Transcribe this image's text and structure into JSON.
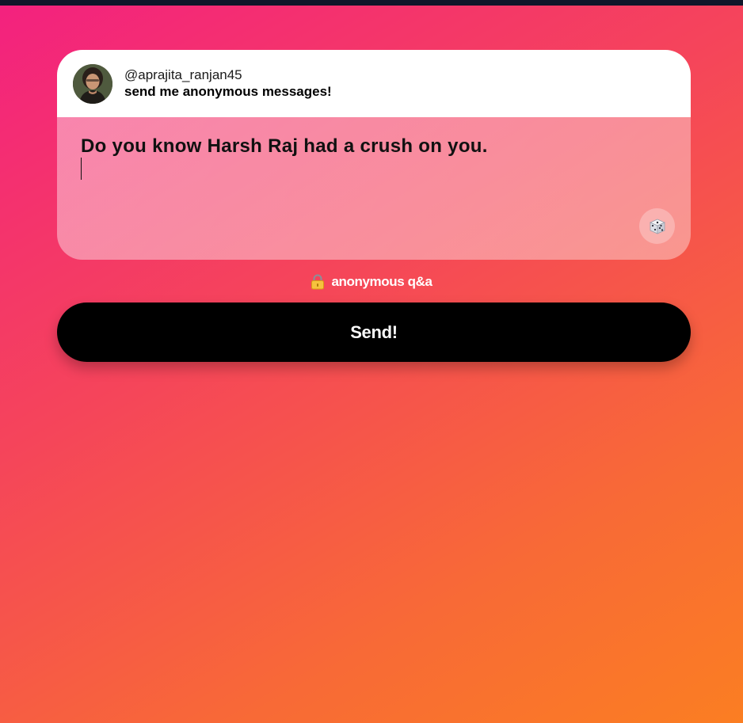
{
  "profile": {
    "username": "@aprajita_ranjan45",
    "prompt": "send me anonymous messages!"
  },
  "message": {
    "text": "Do you know Harsh Raj had a crush on you."
  },
  "footer": {
    "anon_label": "anonymous q&a",
    "lock_icon": "lock-icon"
  },
  "actions": {
    "send_label": "Send!",
    "dice_icon": "dice-icon"
  },
  "colors": {
    "gradient_start": "#f3217f",
    "gradient_end": "#fb7e22",
    "send_button": "#000000"
  }
}
